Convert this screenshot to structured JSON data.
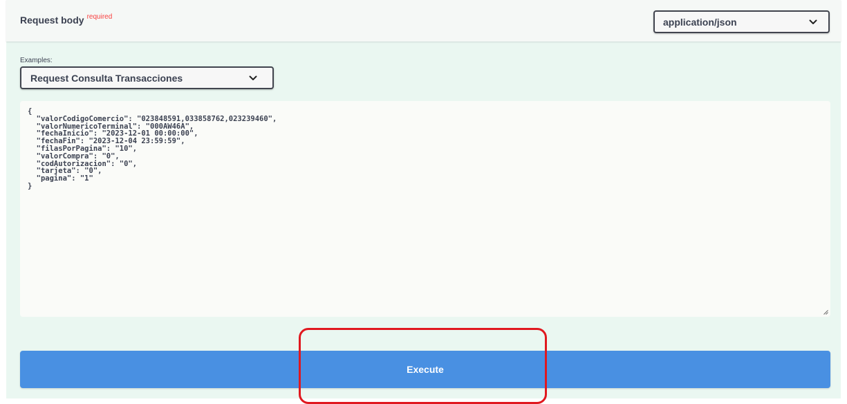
{
  "request_body": {
    "title": "Request body",
    "required_label": "required",
    "content_type": {
      "selected": "application/json",
      "icon": "chevron-down-icon"
    }
  },
  "examples": {
    "label": "Examples:",
    "selected": "Request Consulta Transacciones",
    "icon": "chevron-down-icon"
  },
  "body_editor": {
    "value": "{\n  \"valorCodigoComercio\": \"023848591,033858762,023239460\",\n  \"valorNumericoTerminal\": \"000AW46A\",\n  \"fechaInicio\": \"2023-12-01 00:00:00\",\n  \"fechaFin\": \"2023-12-04 23:59:59\",\n  \"filasPorPagina\": \"10\",\n  \"valorCompra\": \"0\",\n  \"codAutorizacion\": \"0\",\n  \"tarjeta\": \"0\",\n  \"pagina\": \"1\"\n}"
  },
  "execute": {
    "label": "Execute"
  },
  "colors": {
    "panel_bg": "#eaf7f1",
    "execute_bg": "#4990e2",
    "required": "#f93e3e",
    "highlight": "#e0181f"
  }
}
